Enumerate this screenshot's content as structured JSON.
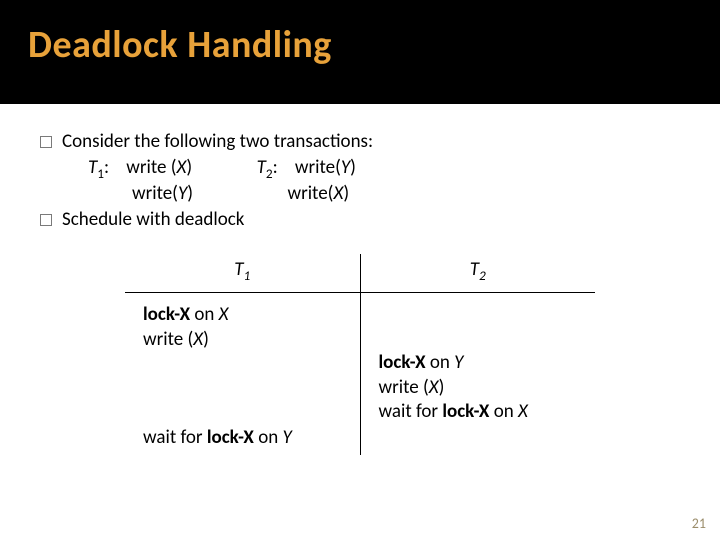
{
  "title": "Deadlock Handling",
  "bullets": {
    "b1": "Consider the following two transactions:",
    "b2": "Schedule with deadlock"
  },
  "trans": {
    "t1_label": "T",
    "t1_sub": "1",
    "t2_label": "T",
    "t2_sub": "2",
    "l1_a": ":    write (",
    "l1_x": "X",
    "l1_b": ")",
    "l1_c": ":    write(",
    "l1_y": "Y",
    "l1_d": ")",
    "l2_a": "write(",
    "l2_y": "Y",
    "l2_b": ")",
    "l2_c": "write(",
    "l2_x": "X",
    "l2_d": ")"
  },
  "table": {
    "h1_t": "T",
    "h1_s": "1",
    "h2_t": "T",
    "h2_s": "2",
    "c1_l1a": "lock-X",
    "c1_l1b": " on ",
    "c1_l1c": "X",
    "c1_l2a": "write (",
    "c1_l2b": "X",
    "c1_l2c": ")",
    "c1_l3a": "wait for ",
    "c1_l3b": "lock-X",
    "c1_l3c": " on ",
    "c1_l3d": "Y",
    "c2_l1a": "lock-X",
    "c2_l1b": " on ",
    "c2_l1c": "Y",
    "c2_l2a": "write (",
    "c2_l2b": "X",
    "c2_l2c": ")",
    "c2_l3a": "wait for ",
    "c2_l3b": "lock-X",
    "c2_l3c": " on ",
    "c2_l3d": "X"
  },
  "pagenum": "21",
  "chart_data": {
    "type": "table",
    "title": "Schedule with deadlock",
    "columns": [
      "T1",
      "T2"
    ],
    "rows": [
      [
        "lock-X on X",
        ""
      ],
      [
        "write (X)",
        ""
      ],
      [
        "",
        "lock-X on Y"
      ],
      [
        "",
        "write (X)"
      ],
      [
        "",
        "wait for lock-X on X"
      ],
      [
        "wait for lock-X on Y",
        ""
      ]
    ]
  }
}
